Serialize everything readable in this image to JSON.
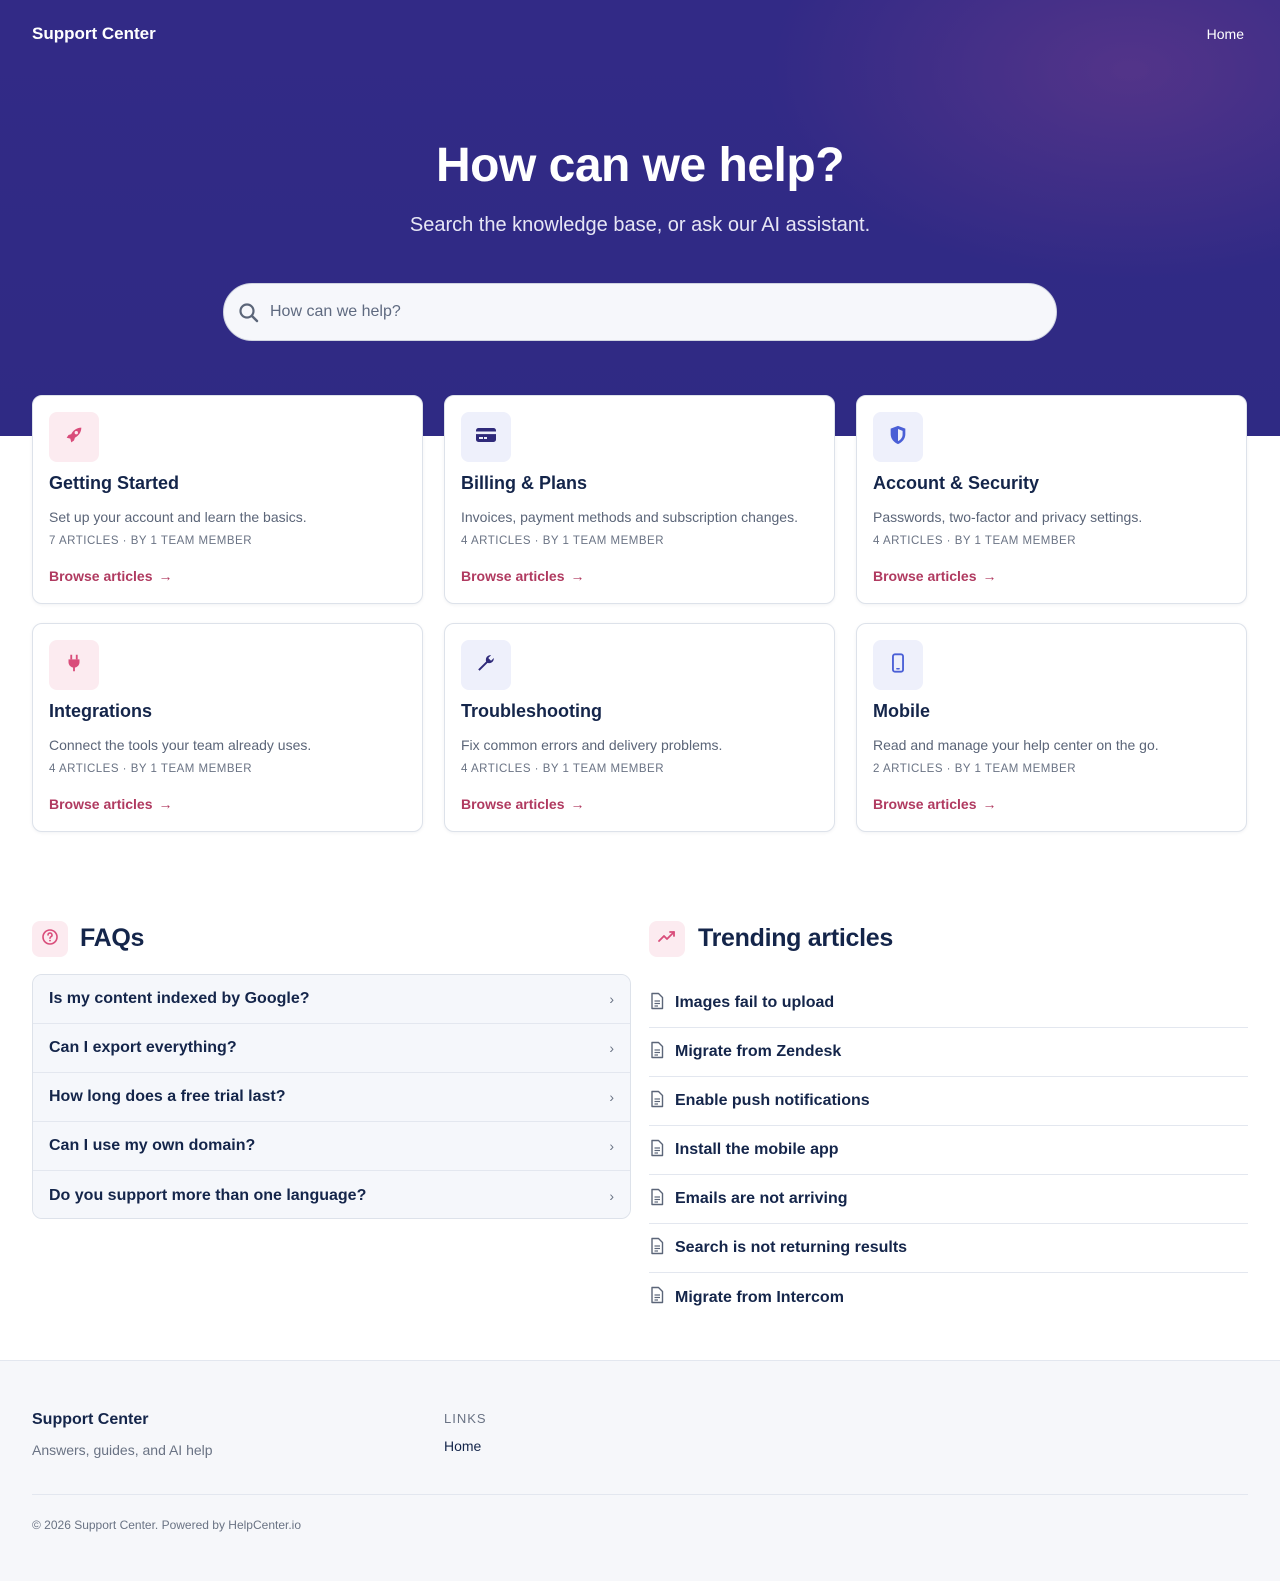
{
  "header": {
    "brand": "Support Center",
    "nav_home": "Home"
  },
  "hero": {
    "title": "How can we help?",
    "subtitle": "Search the knowledge base, or ask our AI assistant.",
    "search_placeholder": "How can we help?"
  },
  "categories": [
    {
      "icon": "rocket-icon",
      "title": "Getting Started",
      "description": "Set up your account and learn the basics.",
      "meta": "7 articles · By 1 team member",
      "link": "Browse articles"
    },
    {
      "icon": "credit-card-icon",
      "title": "Billing & Plans",
      "description": "Invoices, payment methods and subscription changes.",
      "meta": "4 articles · By 1 team member",
      "link": "Browse articles"
    },
    {
      "icon": "shield-icon",
      "title": "Account & Security",
      "description": "Passwords, two-factor and privacy settings.",
      "meta": "4 articles · By 1 team member",
      "link": "Browse articles"
    },
    {
      "icon": "plug-icon",
      "title": "Integrations",
      "description": "Connect the tools your team already uses.",
      "meta": "4 articles · By 1 team member",
      "link": "Browse articles"
    },
    {
      "icon": "wrench-icon",
      "title": "Troubleshooting",
      "description": "Fix common errors and delivery problems.",
      "meta": "4 articles · By 1 team member",
      "link": "Browse articles"
    },
    {
      "icon": "mobile-icon",
      "title": "Mobile",
      "description": "Read and manage your help center on the go.",
      "meta": "2 articles · By 1 team member",
      "link": "Browse articles"
    }
  ],
  "faqs": {
    "title": "FAQs",
    "items": [
      "Is my content indexed by Google?",
      "Can I export everything?",
      "How long does a free trial last?",
      "Can I use my own domain?",
      "Do you support more than one language?"
    ]
  },
  "trending": {
    "title": "Trending articles",
    "items": [
      "Images fail to upload",
      "Migrate from Zendesk",
      "Enable push notifications",
      "Install the mobile app",
      "Emails are not arriving",
      "Search is not returning results",
      "Migrate from Intercom"
    ]
  },
  "footer": {
    "brand": "Support Center",
    "tagline": "Answers, guides, and AI help",
    "links_heading": "Links",
    "home_link": "Home",
    "copyright": "© 2026 Support Center. Powered by HelpCenter.io"
  },
  "colors": {
    "hero_bg": "#312a86",
    "accent": "#b03a60",
    "text": "#14254a",
    "muted": "#6a7384",
    "icon_pink": "#d94c7a",
    "icon_blue": "#4a5fd6"
  }
}
